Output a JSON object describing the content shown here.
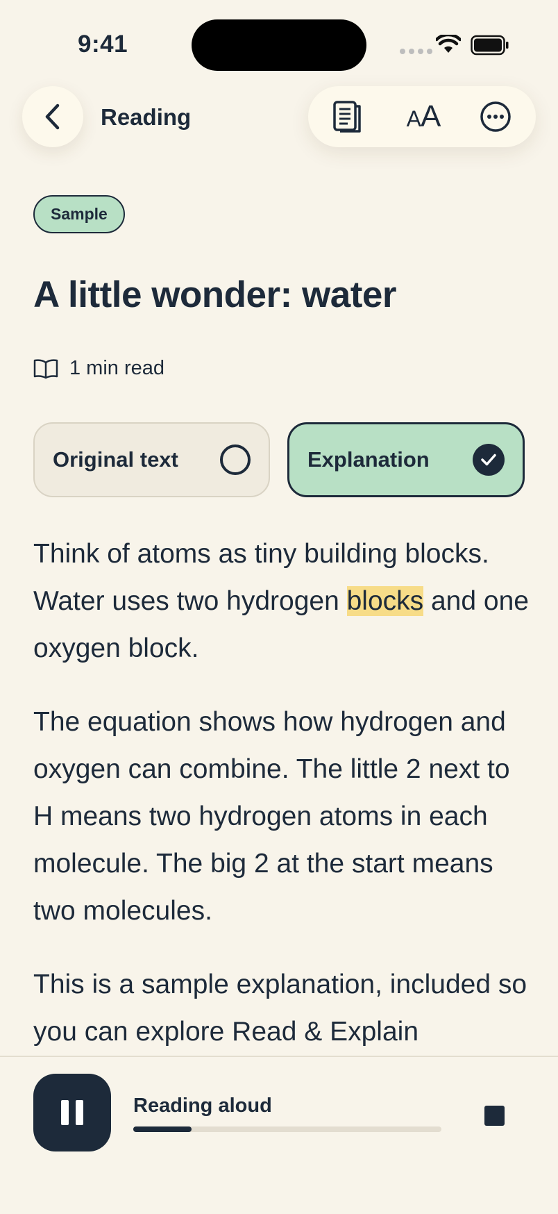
{
  "status_bar": {
    "time": "9:41"
  },
  "header": {
    "title": "Reading"
  },
  "badge": "Sample",
  "article": {
    "title": "A little wonder: water",
    "read_time": "1 min read"
  },
  "modes": {
    "original": {
      "label": "Original text",
      "selected": false
    },
    "explanation": {
      "label": "Explanation",
      "selected": true
    }
  },
  "content": {
    "p1_before": "Think of atoms as tiny building blocks. Water uses two hydrogen ",
    "p1_highlight": "blocks",
    "p1_after": " and one oxygen block.",
    "p2": "The equation shows how hydrogen and oxygen can combine. The little 2 next to H means two hydrogen atoms in each molecule. The big 2 at the start means two molecules.",
    "p3": "This is a sample explanation, included so you can explore Read & Explain"
  },
  "player": {
    "label": "Reading aloud",
    "progress": 0.19
  },
  "colors": {
    "background": "#f8f4ea",
    "accent_green": "#b8e0c5",
    "ink": "#1d2a3a",
    "highlight": "#f7dc88"
  }
}
